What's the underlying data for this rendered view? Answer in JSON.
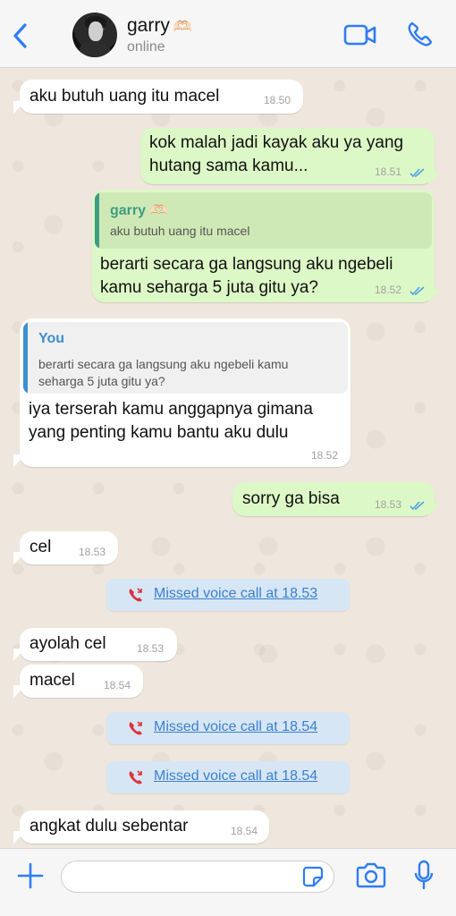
{
  "header": {
    "contact_name": "garry",
    "contact_emoji": "🫶🏻",
    "status": "online",
    "icons": [
      "back-chevron-icon",
      "video-call-icon",
      "phone-icon"
    ],
    "accent": "#2f7cf6"
  },
  "messages": [
    {
      "dir": "in",
      "text": "aku butuh uang itu macel",
      "time": "18.50"
    },
    {
      "dir": "out",
      "text": "kok malah jadi kayak aku ya yang\nhutang sama kamu...",
      "time": "18.51",
      "read": true
    },
    {
      "dir": "out",
      "quote_author": "garry 🫶🏻",
      "quote_text": "aku butuh uang itu macel",
      "text": "berarti secara ga langsung aku ngebeli\nkamu seharga 5 juta gitu ya?",
      "time": "18.52",
      "read": true
    },
    {
      "dir": "in",
      "quote_author": "You",
      "quote_text": "berarti secara ga langsung aku ngebeli kamu\nseharga 5 juta gitu ya?",
      "text": "iya terserah kamu anggapnya gimana\nyang penting kamu bantu aku dulu",
      "time": "18.52"
    },
    {
      "dir": "out",
      "text": "sorry ga bisa",
      "time": "18.53",
      "read": true
    },
    {
      "dir": "in",
      "text": "cel",
      "time": "18.53"
    },
    {
      "dir": "system",
      "text": "Missed voice call at 18.53"
    },
    {
      "dir": "in",
      "text": "ayolah cel",
      "time": "18.53"
    },
    {
      "dir": "in",
      "text": "macel",
      "time": "18.54"
    },
    {
      "dir": "system",
      "text": "Missed voice call at 18.54"
    },
    {
      "dir": "system",
      "text": "Missed voice call at 18.54"
    },
    {
      "dir": "in",
      "text": "angkat dulu sebentar",
      "time": "18.54"
    }
  ],
  "composer": {
    "value": "",
    "icons": [
      "plus-icon",
      "sticker-icon",
      "camera-icon",
      "microphone-icon"
    ]
  },
  "colors": {
    "incoming_bubble": "#ffffff",
    "outgoing_bubble": "#dcf8c6",
    "missed_call_bg": "#d6e6f5",
    "missed_call_text": "#3b7fd0",
    "missed_call_icon": "#e0303a",
    "read_ticks": "#4fa3e0",
    "chat_background": "#efe7dd"
  }
}
